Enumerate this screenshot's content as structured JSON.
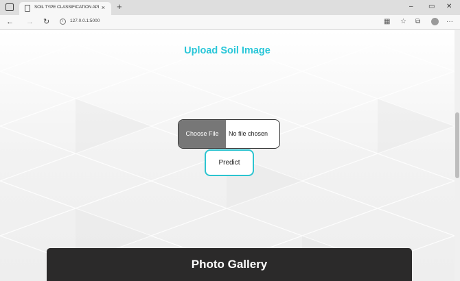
{
  "browser": {
    "tab_title": "SOIL TYPE CLASSIFICATION API",
    "tab_close": "×",
    "new_tab": "+",
    "controls": {
      "minimize": "–",
      "maximize": "▭",
      "close": "✕"
    },
    "url": "127.0.0.1:5000",
    "nav": {
      "back": "←",
      "forward": "→",
      "refresh": "↻"
    },
    "toolbar": {
      "reader": "▦",
      "favorite": "☆",
      "collections": "⧉",
      "more": "···"
    }
  },
  "page": {
    "heading": "Upload Soil Image",
    "file_input": {
      "button_label": "Choose File",
      "status": "No file chosen"
    },
    "predict_label": "Predict",
    "gallery_title": "Photo Gallery"
  },
  "colors": {
    "accent": "#28c6d8",
    "predict_border": "#2cc4d0",
    "choose_button": "#777777",
    "gallery_bg": "#2b2a2a"
  }
}
